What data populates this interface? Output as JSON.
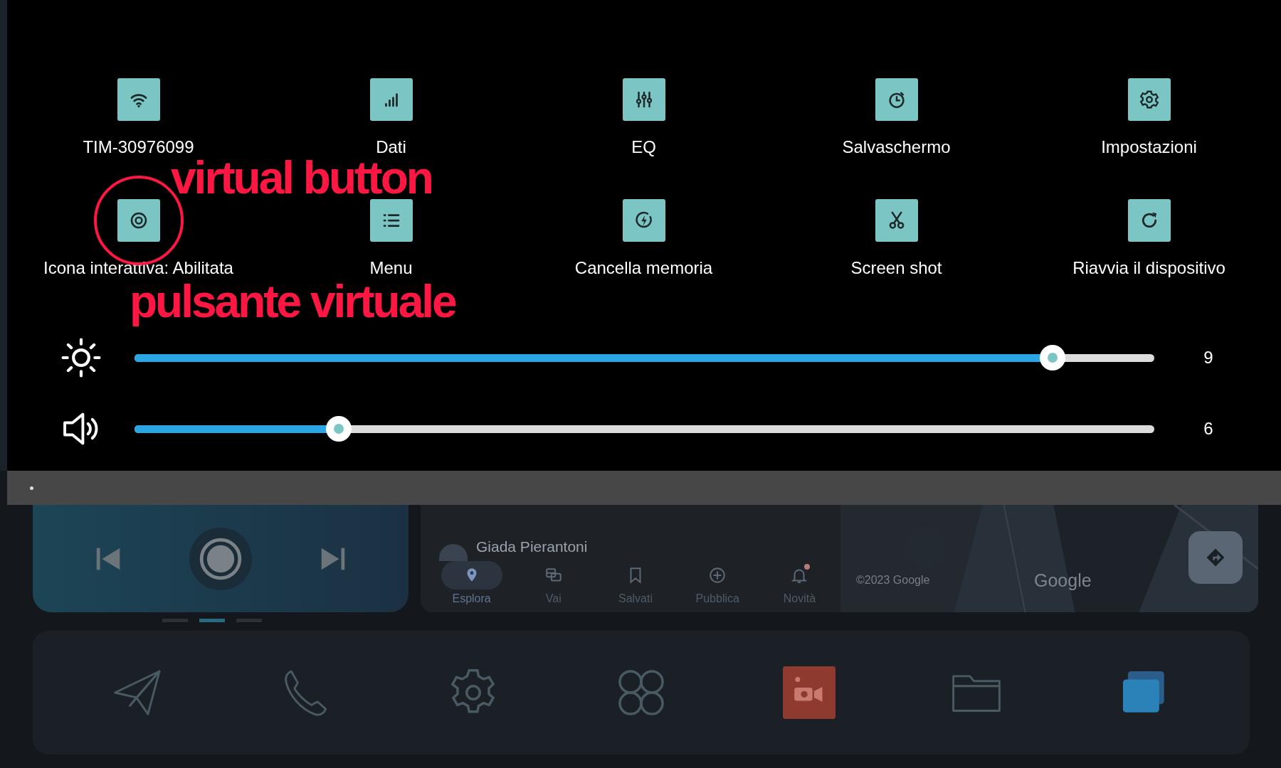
{
  "tiles": [
    {
      "label": "TIM-30976099"
    },
    {
      "label": "Dati"
    },
    {
      "label": "EQ"
    },
    {
      "label": "Salvaschermo"
    },
    {
      "label": "Impostazioni"
    },
    {
      "label": "Icona interattiva: Abilitata"
    },
    {
      "label": "Menu"
    },
    {
      "label": "Cancella memoria"
    },
    {
      "label": "Screen shot"
    },
    {
      "label": "Riavvia il dispositivo"
    }
  ],
  "annotations": [
    {
      "text": "virtual button"
    },
    {
      "text": "pulsante virtuale"
    }
  ],
  "sliders": [
    {
      "kind": "brightness",
      "level": 0.9,
      "reading": "9"
    },
    {
      "kind": "volume",
      "level": 0.2,
      "reading": "6"
    }
  ],
  "home": {
    "media_pages": [
      {
        "selected": false
      },
      {
        "selected": true
      },
      {
        "selected": false
      }
    ],
    "maps": {
      "contact": "Giada Pierantoni",
      "nav": [
        {
          "label": "Esplora",
          "selected": true,
          "badge": false
        },
        {
          "label": "Vai",
          "selected": false,
          "badge": false
        },
        {
          "label": "Salvati",
          "selected": false,
          "badge": false
        },
        {
          "label": "Pubblica",
          "selected": false,
          "badge": false
        },
        {
          "label": "Novità",
          "selected": false,
          "badge": true
        }
      ],
      "copyright": "©2023 Google",
      "logo": "Google"
    }
  }
}
